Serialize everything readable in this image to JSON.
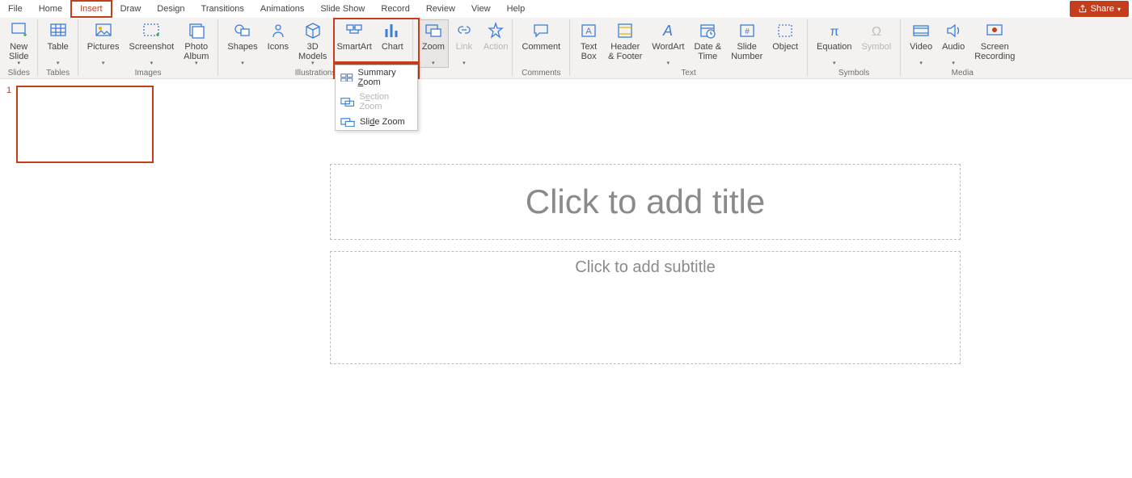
{
  "tabs": {
    "file": "File",
    "home": "Home",
    "insert": "Insert",
    "draw": "Draw",
    "design": "Design",
    "transitions": "Transitions",
    "animations": "Animations",
    "slideshow": "Slide Show",
    "record": "Record",
    "review": "Review",
    "view": "View",
    "help": "Help"
  },
  "share": "Share",
  "groups": {
    "slides": "Slides",
    "tables": "Tables",
    "images": "Images",
    "illustrations": "Illustrations",
    "comments": "Comments",
    "text": "Text",
    "symbols": "Symbols",
    "media": "Media"
  },
  "btn": {
    "newslide": "New\nSlide",
    "table": "Table",
    "pictures": "Pictures",
    "screenshot": "Screenshot",
    "photoalbum": "Photo\nAlbum",
    "shapes": "Shapes",
    "icons": "Icons",
    "models": "3D\nModels",
    "smartart": "SmartArt",
    "chart": "Chart",
    "zoom": "Zoom",
    "link": "Link",
    "action": "Action",
    "comment": "Comment",
    "textbox": "Text\nBox",
    "headerfooter": "Header\n& Footer",
    "wordart": "WordArt",
    "datetime": "Date &\nTime",
    "slidenumber": "Slide\nNumber",
    "object": "Object",
    "equation": "Equation",
    "symbol": "Symbol",
    "video": "Video",
    "audio": "Audio",
    "screenrec": "Screen\nRecording"
  },
  "zoom_menu": {
    "summary": {
      "pre": "Summary ",
      "accel": "Z",
      "post": "oom"
    },
    "section": {
      "pre": "S",
      "accel": "e",
      "post": "ction Zoom"
    },
    "slide": {
      "pre": "Sli",
      "accel": "d",
      "post": "e Zoom"
    }
  },
  "thumb_number": "1",
  "placeholders": {
    "title": "Click to add title",
    "subtitle": "Click to add subtitle"
  },
  "colors": {
    "accent": "#C43E1C"
  }
}
